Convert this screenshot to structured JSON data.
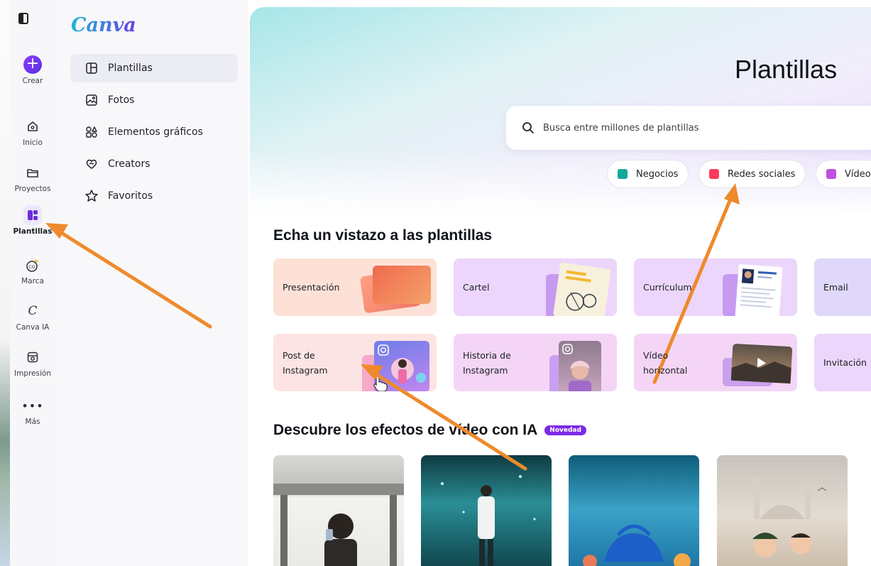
{
  "brand": {
    "logo_text": "Canva"
  },
  "rail": {
    "items": [
      {
        "label": "Crear",
        "icon": "plus-icon"
      },
      {
        "label": "Inicio",
        "icon": "home-icon"
      },
      {
        "label": "Proyectos",
        "icon": "folder-icon"
      },
      {
        "label": "Plantillas",
        "icon": "templates-icon",
        "active": true
      },
      {
        "label": "Marca",
        "icon": "brand-icon"
      },
      {
        "label": "Canva IA",
        "icon": "canva-ai-icon"
      },
      {
        "label": "Impresión",
        "icon": "print-icon"
      },
      {
        "label": "Más",
        "icon": "more-icon"
      }
    ]
  },
  "subnav": {
    "items": [
      {
        "label": "Plantillas",
        "icon": "template-layout-icon",
        "active": true
      },
      {
        "label": "Fotos",
        "icon": "photo-icon"
      },
      {
        "label": "Elementos gráficos",
        "icon": "shapes-icon"
      },
      {
        "label": "Creators",
        "icon": "creators-heart-icon"
      },
      {
        "label": "Favoritos",
        "icon": "star-icon"
      }
    ]
  },
  "main": {
    "title": "Plantillas",
    "search": {
      "placeholder": "Busca entre millones de plantillas"
    },
    "chips": [
      {
        "label": "Negocios",
        "color": "#13a89e"
      },
      {
        "label": "Redes sociales",
        "color": "#ff3b5c"
      },
      {
        "label": "Vídeo",
        "color": "#c04ee0"
      }
    ],
    "templates_section": {
      "title": "Echa un vistazo a las plantillas",
      "cards": [
        {
          "label": "Presentación",
          "bg": "#fde1d7"
        },
        {
          "label": "Cartel",
          "bg": "#ecd6fb"
        },
        {
          "label": "Currículum",
          "bg": "#ecd6fb"
        },
        {
          "label": "Email",
          "bg": "#e0d8fb"
        },
        {
          "label": "Post de\nInstagram",
          "bg": "#fde4e4"
        },
        {
          "label": "Historia de\nInstagram",
          "bg": "#f4d5f6"
        },
        {
          "label": "Vídeo\nhorizontal",
          "bg": "#f4d5f6"
        },
        {
          "label": "Invitación",
          "bg": "#ecd6fb"
        }
      ]
    },
    "video_section": {
      "title": "Descubre los efectos de vídeo con IA",
      "badge": "Novedad"
    }
  },
  "colors": {
    "accent": "#7d2ae8",
    "annotation_arrow": "#ee8a2c"
  }
}
